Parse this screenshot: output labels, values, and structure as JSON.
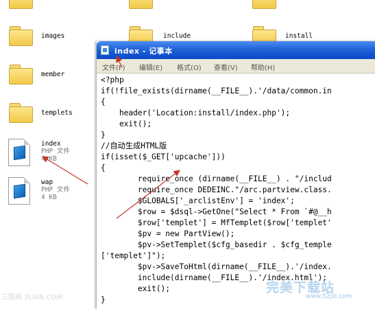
{
  "explorer": {
    "items": [
      {
        "name": "images",
        "type": "folder"
      },
      {
        "name": "include",
        "type": "folder"
      },
      {
        "name": "install",
        "type": "folder"
      },
      {
        "name": "member",
        "type": "folder"
      },
      {
        "name": "templets",
        "type": "folder"
      },
      {
        "name": "index",
        "type": "php",
        "kind": "PHP 文件",
        "size": "4 KB"
      },
      {
        "name": "wap",
        "type": "php",
        "kind": "PHP 文件",
        "size": "4 KB"
      }
    ]
  },
  "notepad": {
    "title": "index - 记事本",
    "menu": [
      "文件(F)",
      "编辑(E)",
      "格式(O)",
      "查看(V)",
      "帮助(H)"
    ],
    "lines": [
      "<?php",
      "if(!file_exists(dirname(__FILE__).'/data/common.in",
      "{",
      "    header('Location:install/index.php');",
      "    exit();",
      "}",
      "//自动生成HTML版",
      "if(isset($_GET['upcache']))",
      "{",
      "        require_once (dirname(__FILE__) . \"/includ",
      "        require_once DEDEINC.\"/arc.partview.class.",
      "        $GLOBALS['_arclistEnv'] = 'index';",
      "        $row = $dsql->GetOne(\"Select * From `#@__h",
      "        $row['templet'] = MfTemplet($row['templet'",
      "        $pv = new PartView();",
      "        $pv->SetTemplet($cfg_basedir . $cfg_temple",
      "['templet']\");",
      "        $pv->SaveToHtml(dirname(__FILE__).'/index.",
      "        include(dirname(__FILE__).'/index.html');",
      "        exit();",
      "}"
    ]
  },
  "watermarks": {
    "left": "三联网 3LIAN.COM",
    "right": "完美下载站",
    "url": "www.52jsl.com"
  },
  "colors": {
    "titlebar": "#0a48c8",
    "arrow": "#c0392b",
    "folder": "#f3c948"
  }
}
